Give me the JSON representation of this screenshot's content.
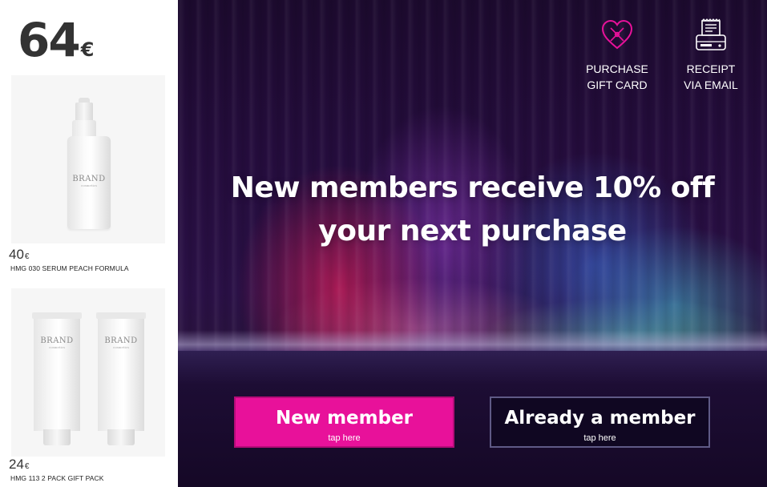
{
  "cart": {
    "total": {
      "amount": "64",
      "currency": "€"
    },
    "products": [
      {
        "price": "40",
        "currency": "€",
        "name": "HMG 030 SERUM PEACH FORMULA",
        "brand": "BRAND",
        "brand_sub": "cosmetics"
      },
      {
        "price": "24",
        "currency": "€",
        "name": "HMG 113 2 PACK GIFT PACK",
        "brand": "BRAND",
        "brand_sub": "cosmetics"
      }
    ]
  },
  "screen": {
    "actions": [
      {
        "icon": "heart-gift-icon",
        "line1": "PURCHASE",
        "line2": "GIFT CARD",
        "color": "#e8119a"
      },
      {
        "icon": "receipt-printer-icon",
        "line1": "RECEIPT",
        "line2": "VIA EMAIL",
        "color": "#ffffff"
      }
    ],
    "headline": {
      "line1": "New members receive 10% off",
      "line2": "your next purchase"
    },
    "buttons": {
      "new_member": {
        "label": "New member",
        "sub": "tap here",
        "color": "#e8119a"
      },
      "existing_member": {
        "label": "Already a member",
        "sub": "tap here",
        "color": "#100722"
      }
    }
  }
}
